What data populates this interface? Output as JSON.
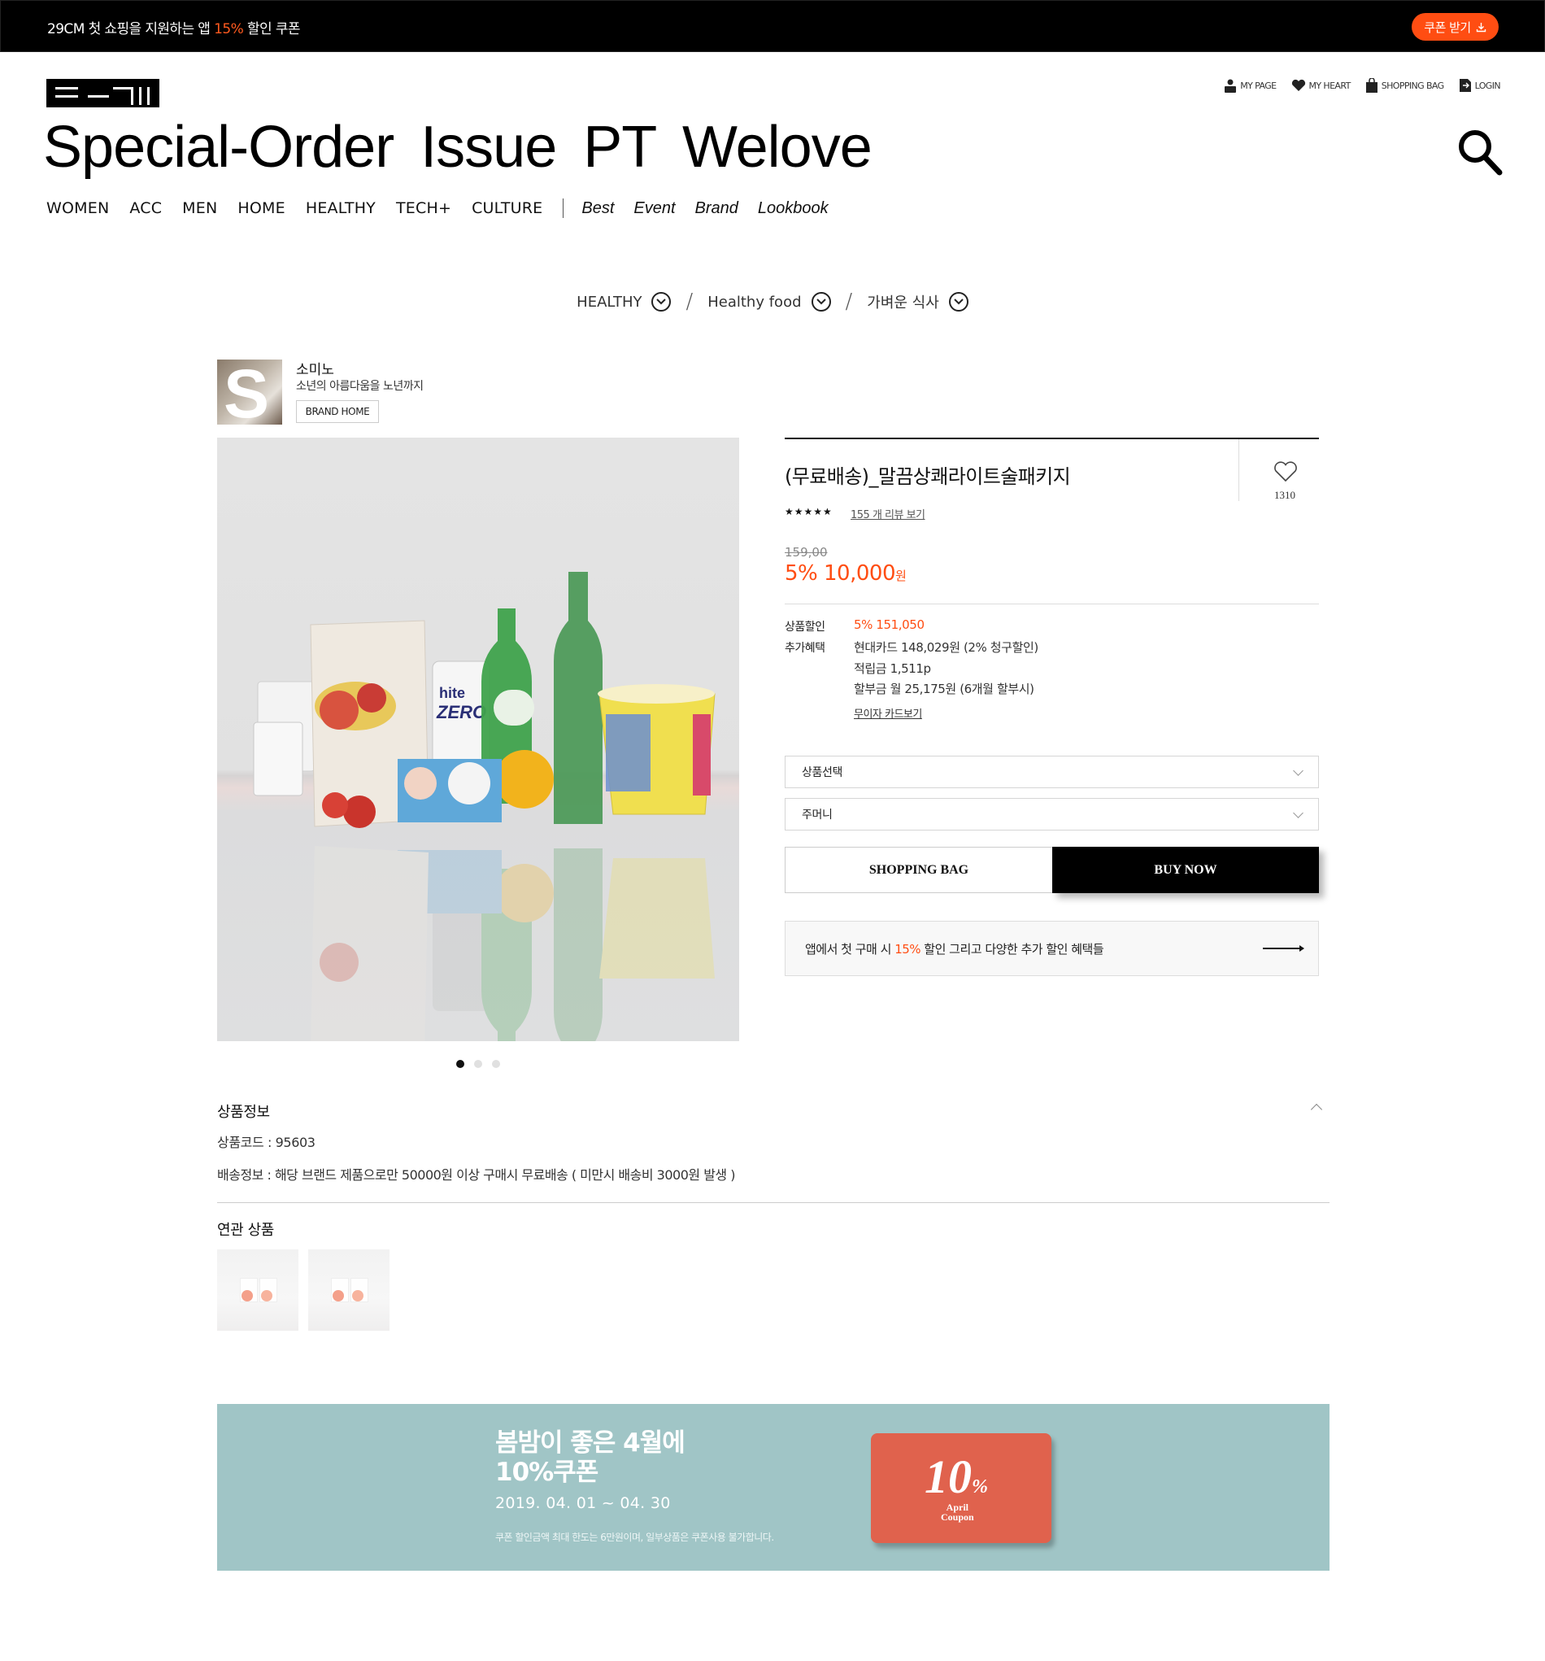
{
  "topbar": {
    "message_prefix": "29CM 첫 쇼핑을 지원하는 앱 ",
    "message_highlight": "15%",
    "message_suffix": " 할인 쿠폰",
    "coupon_button": "쿠폰 받기"
  },
  "util_nav": [
    {
      "label": "MY PAGE",
      "icon": "person-icon"
    },
    {
      "label": "MY HEART",
      "icon": "heart-icon"
    },
    {
      "label": "SHOPPING BAG",
      "icon": "bag-icon"
    },
    {
      "label": "LOGIN",
      "icon": "login-icon"
    }
  ],
  "page_title": "Special-Order Issue PT Welove",
  "gnb": {
    "categories": [
      "WOMEN",
      "ACC",
      "MEN",
      "HOME",
      "HEALTHY",
      "TECH+",
      "CULTURE"
    ],
    "sub": [
      "Best",
      "Event",
      "Brand",
      "Lookbook"
    ]
  },
  "breadcrumb": [
    "HEALTHY",
    "Healthy food",
    "가벼운 식사"
  ],
  "brand": {
    "thumb_letter": "S",
    "name": "소미노",
    "slogan": "소년의 아름다움을 노년까지",
    "home_button": "BRAND HOME"
  },
  "product": {
    "title": "(무료배송)_말끔상쾌라이트술패키지",
    "heart_count": "1310",
    "stars": "★★★★★",
    "review_link": "155 개 리뷰 보기",
    "original_price": "159,00",
    "sale_price": "5% 10,000",
    "sale_unit": "원",
    "discount_label": "상품할인",
    "discount_value": "5% 151,050",
    "benefit_label": "추가혜택",
    "benefits": [
      "현대카드 148,029원 (2% 청구할인)",
      "적립금 1,511p",
      "할부금 월 25,175원 (6개월 할부시)"
    ],
    "card_link": "무이자 카드보기",
    "select_1": "상품선택",
    "select_2": "주머니",
    "bag_button": "SHOPPING BAG",
    "buy_button": "BUY NOW",
    "app_banner_prefix": "앱에서 첫 구매 시 ",
    "app_banner_highlight": "15%",
    "app_banner_suffix": " 할인 그리고 다양한 추가 할인 혜택들",
    "image_slides": 3,
    "active_slide": 1
  },
  "info": {
    "title": "상품정보",
    "code": "상품코드 : 95603",
    "shipping": "배송정보 : 해당 브랜드 제품으로만 50000원 이상 구매시 무료배송 ( 미만시 배송비 3000원 발생 )"
  },
  "related": {
    "title": "연관 상품",
    "count": 2
  },
  "promo": {
    "headline_1": "봄밤이 좋은 4월에",
    "headline_2": "10%쿠폰",
    "date": "2019. 04. 01 ~ 04. 30",
    "note": "쿠폰 할인금액 최대 한도는 6만원이며, 일부상품은 쿠폰사용 불가합니다.",
    "coupon_big": "10",
    "coupon_pct": "%",
    "coupon_sub_1": "April",
    "coupon_sub_2": "Coupon"
  },
  "colors": {
    "accent": "#ff4d12",
    "promo_bg": "#a0c5c6",
    "coupon": "#e0624d"
  }
}
